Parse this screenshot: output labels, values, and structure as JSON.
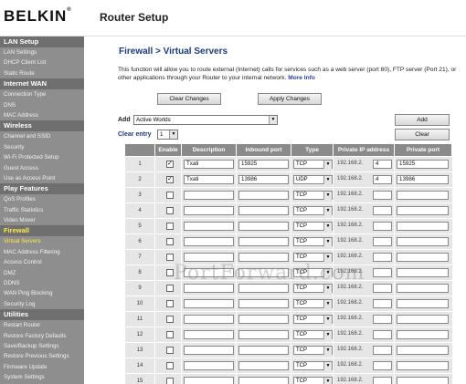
{
  "header": {
    "logo": "BELKIN",
    "app_title": "Router Setup"
  },
  "sidebar": {
    "sections": [
      {
        "title": "LAN Setup",
        "items": [
          "LAN Settings",
          "DHCP Client List",
          "Static Route"
        ]
      },
      {
        "title": "Internet WAN",
        "items": [
          "Connection Type",
          "DNS",
          "MAC Address"
        ]
      },
      {
        "title": "Wireless",
        "items": [
          "Channel and SSID",
          "Security",
          "Wi-Fi Protected Setup",
          "Guest Access",
          "Use as Access Point"
        ]
      },
      {
        "title": "Play Features",
        "items": [
          "QoS Profiles",
          "Traffic Statistics",
          "Video Mover"
        ]
      },
      {
        "title": "Firewall",
        "items": [
          "Virtual Servers",
          "MAC Address Filtering",
          "Access Control",
          "DMZ",
          "DDNS",
          "WAN Ping Blocking",
          "Security Log"
        ]
      },
      {
        "title": "Utilities",
        "items": [
          "Restart Router",
          "Restore Factory Defaults",
          "Save/Backup Settings",
          "Restore Previous Settings",
          "Firmware Update",
          "System Settings"
        ]
      }
    ]
  },
  "main": {
    "title": "Firewall > Virtual Servers",
    "description": "This function will allow you to route external (Internet) calls for services such as a web server (port 80), FTP server (Port 21), or other applications through your Router to your internal network.",
    "more_info": "More Info",
    "clear_changes": "Clear Changes",
    "apply_changes": "Apply Changes",
    "add_label": "Add",
    "add_select": "Active Worlds",
    "add_button": "Add",
    "clear_entry_label": "Clear entry",
    "clear_entry_select": "1",
    "clear_button": "Clear",
    "columns": [
      "",
      "Enable",
      "Description",
      "Inbound port",
      "Type",
      "Private IP address",
      "Private port"
    ],
    "ip_prefix": "192.168.2.",
    "rows": [
      {
        "n": "1",
        "enabled": true,
        "desc": "Txati",
        "inbound": "15925",
        "type": "TCP",
        "ip": "4",
        "private": "15925"
      },
      {
        "n": "2",
        "enabled": true,
        "desc": "Txati",
        "inbound": "13986",
        "type": "UDP",
        "ip": "4",
        "private": "13986"
      },
      {
        "n": "3",
        "enabled": false,
        "desc": "",
        "inbound": "",
        "type": "TCP",
        "ip": "",
        "private": ""
      },
      {
        "n": "4",
        "enabled": false,
        "desc": "",
        "inbound": "",
        "type": "TCP",
        "ip": "",
        "private": ""
      },
      {
        "n": "5",
        "enabled": false,
        "desc": "",
        "inbound": "",
        "type": "TCP",
        "ip": "",
        "private": ""
      },
      {
        "n": "6",
        "enabled": false,
        "desc": "",
        "inbound": "",
        "type": "TCP",
        "ip": "",
        "private": ""
      },
      {
        "n": "7",
        "enabled": false,
        "desc": "",
        "inbound": "",
        "type": "TCP",
        "ip": "",
        "private": ""
      },
      {
        "n": "8",
        "enabled": false,
        "desc": "",
        "inbound": "",
        "type": "TCP",
        "ip": "",
        "private": ""
      },
      {
        "n": "9",
        "enabled": false,
        "desc": "",
        "inbound": "",
        "type": "TCP",
        "ip": "",
        "private": ""
      },
      {
        "n": "10",
        "enabled": false,
        "desc": "",
        "inbound": "",
        "type": "TCP",
        "ip": "",
        "private": ""
      },
      {
        "n": "11",
        "enabled": false,
        "desc": "",
        "inbound": "",
        "type": "TCP",
        "ip": "",
        "private": ""
      },
      {
        "n": "12",
        "enabled": false,
        "desc": "",
        "inbound": "",
        "type": "TCP",
        "ip": "",
        "private": ""
      },
      {
        "n": "13",
        "enabled": false,
        "desc": "",
        "inbound": "",
        "type": "TCP",
        "ip": "",
        "private": ""
      },
      {
        "n": "14",
        "enabled": false,
        "desc": "",
        "inbound": "",
        "type": "TCP",
        "ip": "",
        "private": ""
      },
      {
        "n": "15",
        "enabled": false,
        "desc": "",
        "inbound": "",
        "type": "TCP",
        "ip": "",
        "private": ""
      }
    ]
  },
  "watermark": "PortForward.com",
  "colors": {
    "sidebar": "#8e8e8e",
    "sidebar_header": "#6f6f6f",
    "active": "#ffe84a",
    "title": "#1b3a7a",
    "table_header": "#8a8a8a",
    "row": "#e6e6e6"
  }
}
